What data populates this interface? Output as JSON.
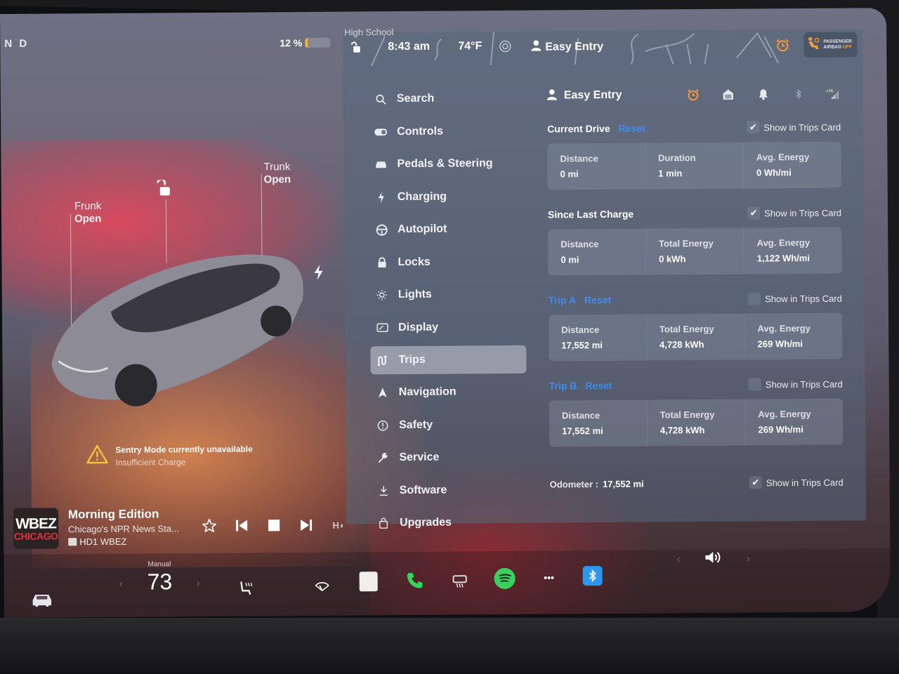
{
  "vehicle": {
    "gear": "N D",
    "battery_percent_label": "12 %",
    "battery_level": 0.12,
    "frunk": {
      "label": "Frunk",
      "state": "Open"
    },
    "trunk": {
      "label": "Trunk",
      "state": "Open"
    },
    "alert": {
      "title": "Sentry Mode currently unavailable",
      "subtitle": "Insufficient Charge"
    }
  },
  "media": {
    "logo_top": "WBEZ",
    "logo_bottom": "CHICAGO",
    "title": "Morning Edition",
    "subtitle": "Chicago's NPR News Sta...",
    "source": "HD1 WBEZ"
  },
  "status_bar": {
    "map_label": "High School",
    "time": "8:43 am",
    "temperature": "74°F",
    "profile": "Easy Entry",
    "airbag_line1": "PASSENGER",
    "airbag_line2": "AIRBAG",
    "airbag_state": "OFF"
  },
  "nav": {
    "items": [
      {
        "label": "Search",
        "icon": "search-icon"
      },
      {
        "label": "Controls",
        "icon": "toggle-icon"
      },
      {
        "label": "Pedals & Steering",
        "icon": "car-icon"
      },
      {
        "label": "Charging",
        "icon": "bolt-icon"
      },
      {
        "label": "Autopilot",
        "icon": "steering-wheel-icon"
      },
      {
        "label": "Locks",
        "icon": "lock-icon"
      },
      {
        "label": "Lights",
        "icon": "sun-icon"
      },
      {
        "label": "Display",
        "icon": "display-icon"
      },
      {
        "label": "Trips",
        "icon": "trips-icon",
        "active": true
      },
      {
        "label": "Navigation",
        "icon": "navigation-arrow-icon"
      },
      {
        "label": "Safety",
        "icon": "alert-circle-icon"
      },
      {
        "label": "Service",
        "icon": "wrench-icon"
      },
      {
        "label": "Software",
        "icon": "download-icon"
      },
      {
        "label": "Upgrades",
        "icon": "shopping-bag-icon"
      }
    ]
  },
  "trips": {
    "profile": "Easy Entry",
    "show_in_trips_card": "Show in Trips Card",
    "reset": "Reset",
    "current_drive": {
      "title": "Current Drive",
      "checked": true,
      "stats": [
        {
          "label": "Distance",
          "value": "0 mi"
        },
        {
          "label": "Duration",
          "value": "1 min"
        },
        {
          "label": "Avg. Energy",
          "value": "0 Wh/mi"
        }
      ]
    },
    "since_last_charge": {
      "title": "Since Last Charge",
      "checked": true,
      "stats": [
        {
          "label": "Distance",
          "value": "0 mi"
        },
        {
          "label": "Total Energy",
          "value": "0 kWh"
        },
        {
          "label": "Avg. Energy",
          "value": "1,122 Wh/mi"
        }
      ]
    },
    "trip_a": {
      "title": "Trip A",
      "checked": false,
      "stats": [
        {
          "label": "Distance",
          "value": "17,552 mi"
        },
        {
          "label": "Total Energy",
          "value": "4,728 kWh"
        },
        {
          "label": "Avg. Energy",
          "value": "269 Wh/mi"
        }
      ]
    },
    "trip_b": {
      "title": "Trip B",
      "checked": false,
      "stats": [
        {
          "label": "Distance",
          "value": "17,552 mi"
        },
        {
          "label": "Total Energy",
          "value": "4,728 kWh"
        },
        {
          "label": "Avg. Energy",
          "value": "269 Wh/mi"
        }
      ]
    },
    "odometer": {
      "label": "Odometer :",
      "value": "17,552 mi",
      "checked": true
    }
  },
  "dock": {
    "temp_mode": "Manual",
    "temperature": "73"
  },
  "colors": {
    "accent_blue": "#3e8bf1",
    "alert_orange": "#f29a3b",
    "battery_yellow": "#f2b233",
    "spotify_green": "#3bd15e",
    "phone_green": "#37d45b",
    "bluetooth_blue": "#2d96ef"
  }
}
